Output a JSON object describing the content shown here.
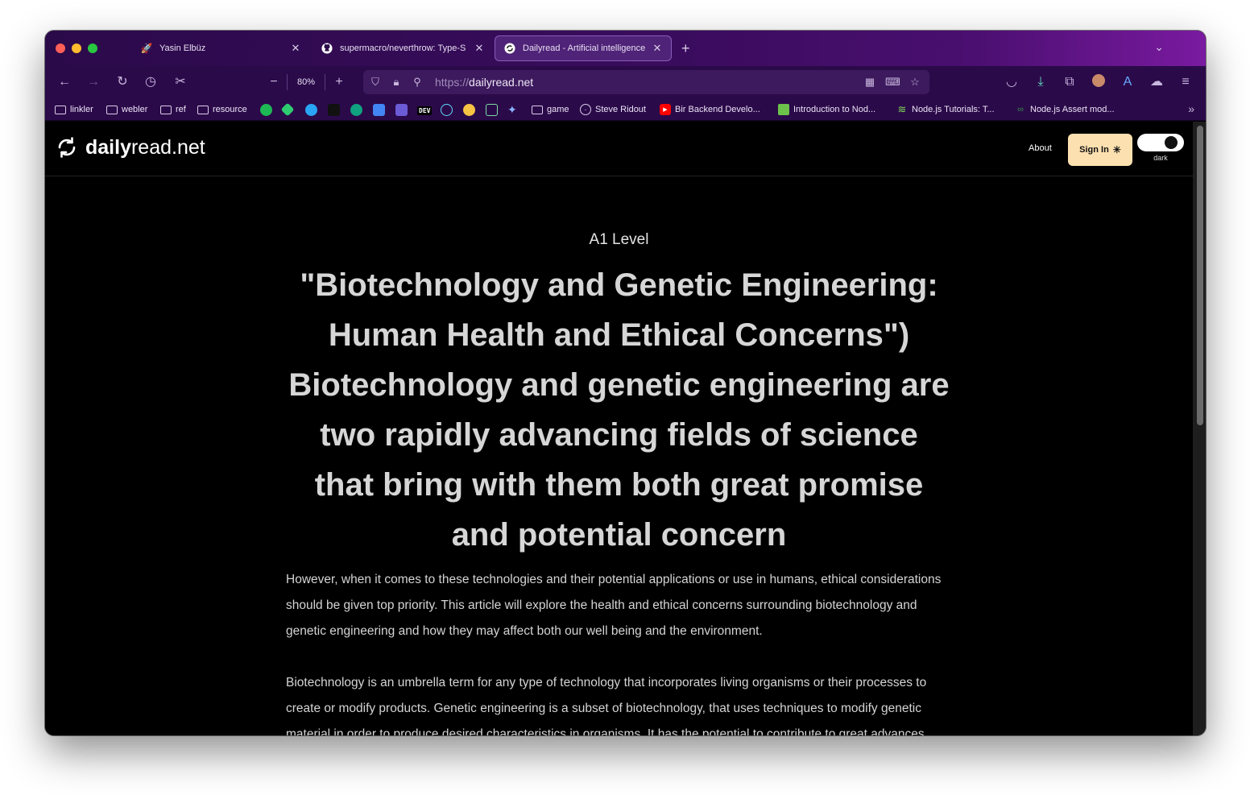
{
  "browser": {
    "tabs": [
      {
        "title": "Yasin Elbüz",
        "icon": "rocket-icon"
      },
      {
        "title": "supermacro/neverthrow: Type-S",
        "icon": "github-icon"
      },
      {
        "title": "Dailyread - Artificial intelligence",
        "icon": "dailyread-icon",
        "active": true
      }
    ],
    "zoom": "80%",
    "url_scheme": "https://",
    "url_host": "dailyread.net",
    "bookmarks": [
      {
        "label": "linkler",
        "type": "folder"
      },
      {
        "label": "webler",
        "type": "folder"
      },
      {
        "label": "ref",
        "type": "folder"
      },
      {
        "label": "resource",
        "type": "folder"
      },
      {
        "label": "game",
        "type": "folder"
      },
      {
        "label": "Steve Ridout",
        "type": "link"
      },
      {
        "label": "Bir Backend Develo...",
        "type": "link"
      },
      {
        "label": "Introduction to Nod...",
        "type": "link"
      },
      {
        "label": "Node.js Tutorials: T...",
        "type": "link"
      },
      {
        "label": "Node.js Assert mod...",
        "type": "link"
      }
    ],
    "dev_badge": "DEV"
  },
  "site": {
    "logo_bold": "daily",
    "logo_rest": "read.net",
    "nav_about": "About",
    "sign_in": "Sign In",
    "theme_label": "dark"
  },
  "article": {
    "level": "A1 Level",
    "headline": "\"Biotechnology and Genetic Engineering: Human Health and Ethical Concerns\") Biotechnology and genetic engineering are two rapidly advancing fields of science that bring with them both great promise and potential concern",
    "paragraph1": "However, when it comes to these technologies and their potential applications or use in humans, ethical considerations should be given top priority. This article will explore the health and ethical concerns surrounding biotechnology and genetic engineering and how they may affect both our well being and the environment.",
    "paragraph2": "Biotechnology is an umbrella term for any type of technology that incorporates living organisms or their processes to create or modify products. Genetic engineering is a subset of biotechnology, that uses techniques to modify genetic material in order to produce desired characteristics in organisms. It has the potential to contribute to great advances"
  },
  "colors": {
    "browser_chrome": "#2b0a4a",
    "page_background": "#000000",
    "sign_in_button": "#fde0b0"
  }
}
